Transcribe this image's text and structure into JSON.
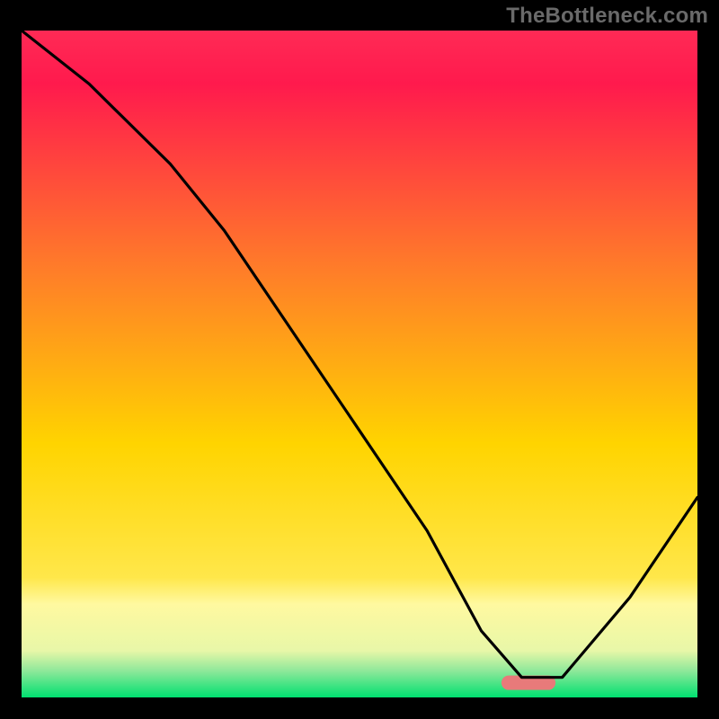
{
  "watermark": "TheBottleneck.com",
  "chart_data": {
    "type": "line",
    "title": "",
    "xlabel": "",
    "ylabel": "",
    "xlim": [
      0,
      100
    ],
    "ylim": [
      0,
      100
    ],
    "grid": false,
    "legend": "none",
    "background": {
      "top_color": "#ff1a4d",
      "mid_color": "#ffd400",
      "lower_band_color": "#fff9a0",
      "bottom_color": "#00e070"
    },
    "highlight_band": {
      "x_start": 71,
      "x_end": 79,
      "y": 2.2,
      "color": "#e87a7a"
    },
    "series": [
      {
        "name": "bottleneck-curve",
        "x": [
          0,
          10,
          22,
          30,
          40,
          50,
          60,
          68,
          74,
          80,
          90,
          100
        ],
        "y": [
          100,
          92,
          80,
          70,
          55,
          40,
          25,
          10,
          3,
          3,
          15,
          30
        ],
        "color": "#000000"
      }
    ]
  }
}
